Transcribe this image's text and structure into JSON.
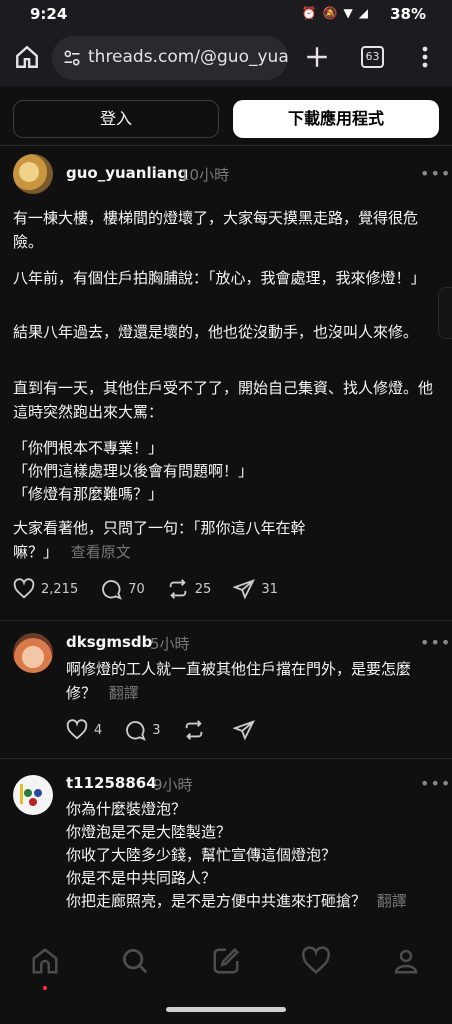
{
  "status": {
    "time": "9:24",
    "battery": "38%"
  },
  "browser": {
    "url": "threads.com/@guo_yuanliang",
    "tab_count": "63"
  },
  "auth": {
    "login": "登入",
    "download_app": "下載應用程式"
  },
  "post": {
    "username": "guo_yuanliang",
    "time": "10小時",
    "paragraphs": [
      "有一棟大樓，樓梯間的燈壞了，大家每天摸黑走路，覺得很危險。",
      "八年前，有個住戶拍胸脯說：「放心，我會處理，我來修燈！」",
      "結果八年過去，燈還是壞的，他也從沒動手，也沒叫人來修。",
      "直到有一天，其他住戶受不了了，開始自己集資、找人修燈。他這時突然跑出來大罵：",
      "「你們根本不專業！」",
      "「你們這樣處理以後會有問題啊！」",
      "「修燈有那麼難嗎？」",
      "大家看著他，只問了一句：「那你這八年在幹嘛？」"
    ],
    "see_original": "查看原文",
    "likes": "2,215",
    "comments": "70",
    "reposts": "25",
    "shares": "31"
  },
  "replies": [
    {
      "username": "dksgmsdb",
      "time": "5小時",
      "text": "啊修燈的工人就一直被其他住戶擋在門外，是要怎麼修？",
      "translate": "翻譯",
      "likes": "4",
      "comments": "3"
    },
    {
      "username": "t11258864",
      "time": "9小時",
      "lines": [
        "你為什麼裝燈泡？",
        "你燈泡是不是大陸製造？",
        "你收了大陸多少錢，幫忙宣傳這個燈泡？",
        "你是不是中共同路人？",
        "你把走廊照亮，是不是方便中共進來打砸搶？"
      ],
      "translate": "翻譯"
    }
  ],
  "icons": [
    "home-icon",
    "search-icon",
    "compose-icon",
    "heart-icon",
    "profile-icon"
  ]
}
